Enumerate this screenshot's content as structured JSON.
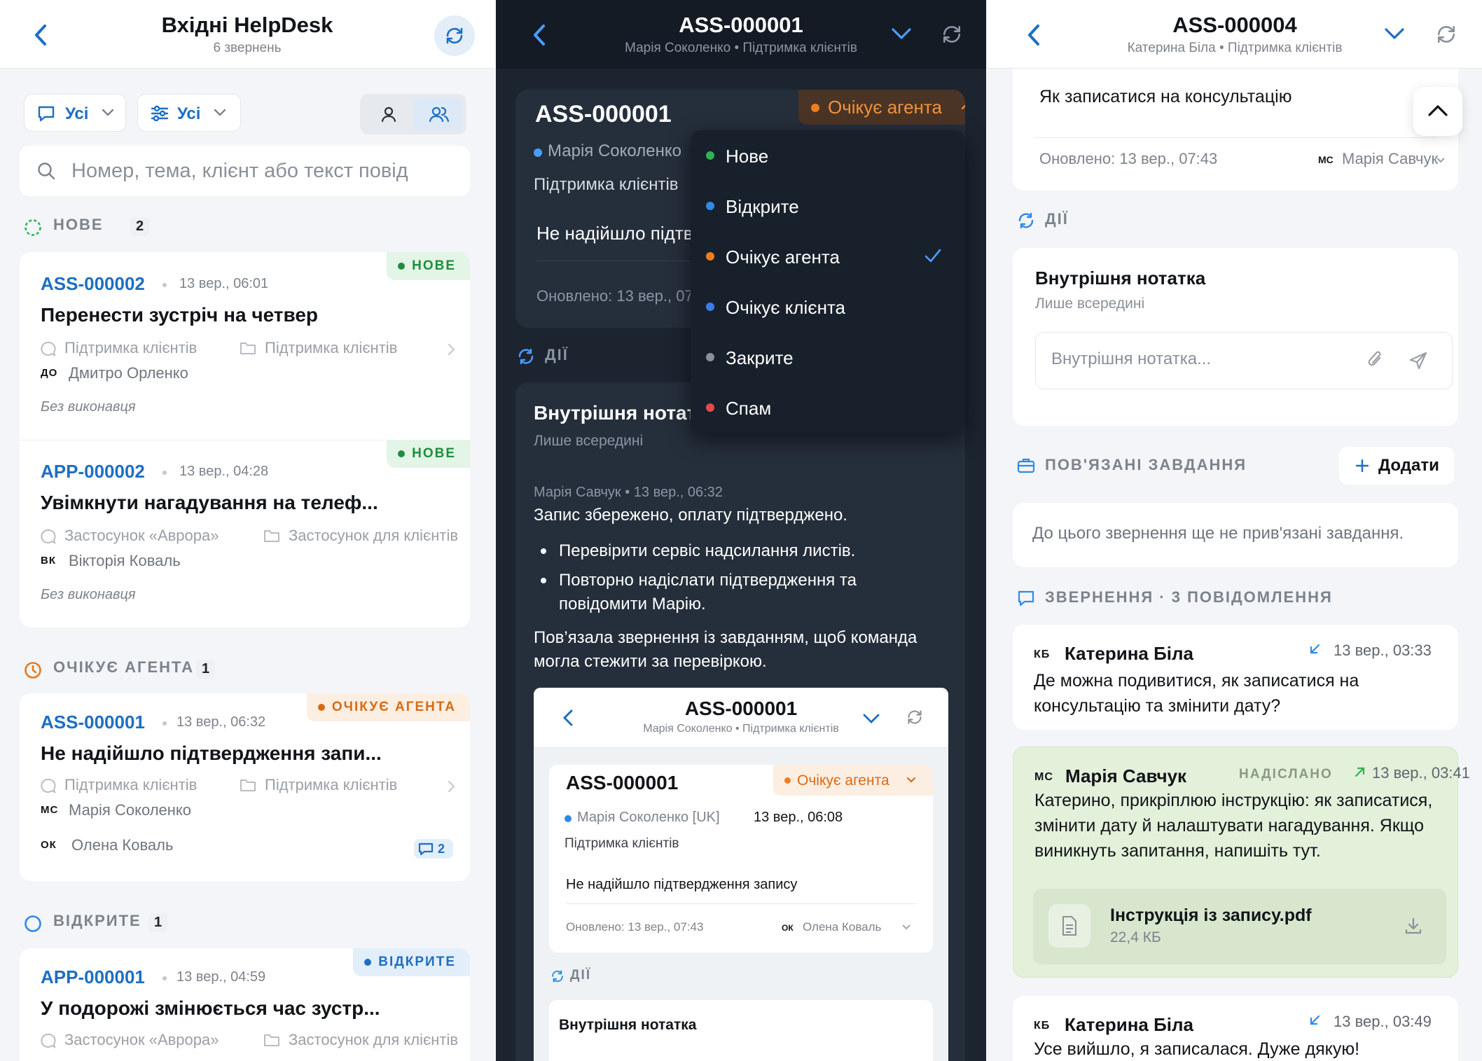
{
  "left": {
    "title": "Вхідні HelpDesk",
    "subtitle": "6 звернень",
    "filter1": "Усі",
    "filter2": "Усі",
    "search_placeholder": "Номер, тема, клієнт або текст повід",
    "groups": [
      {
        "label": "НОВЕ",
        "count": "2"
      },
      {
        "label": "ОЧІКУЄ АГЕНТА",
        "count": "1"
      },
      {
        "label": "ВІДКРИТЕ",
        "count": "1"
      }
    ],
    "tickets": [
      {
        "id": "ASS-000002",
        "time": "13 вер., 06:01",
        "badge": "НОВЕ",
        "title": "Перенести зустріч на четвер",
        "channel": "Підтримка клієнтів",
        "folder": "Підтримка клієнтів",
        "client_initials": "ДО",
        "client": "Дмитро Орленко",
        "assignee": "Без виконавця"
      },
      {
        "id": "APP-000002",
        "time": "13 вер., 04:28",
        "badge": "НОВЕ",
        "title": "Увімкнути нагадування на телеф...",
        "channel": "Застосунок «Аврора»",
        "folder": "Застосунок для клієнтів",
        "client_initials": "ВК",
        "client": "Вікторія Коваль",
        "assignee": "Без виконавця"
      },
      {
        "id": "ASS-000001",
        "time": "13 вер., 06:32",
        "badge": "ОЧІКУЄ АГЕНТА",
        "title": "Не надійшло підтвердження запи...",
        "channel": "Підтримка клієнтів",
        "folder": "Підтримка клієнтів",
        "client_initials": "МС",
        "client": "Марія Соколенко",
        "agent_initials": "ОК",
        "agent": "Олена Коваль",
        "messages": "2"
      },
      {
        "id": "APP-000001",
        "time": "13 вер., 04:59",
        "badge": "ВІДКРИТЕ",
        "title": "У подорожі змінюється час зустр...",
        "channel": "Застосунок «Аврора»",
        "folder": "Застосунок для клієнтів"
      }
    ]
  },
  "middle": {
    "title": "ASS-000001",
    "subtitle": "Марія Соколенко • Підтримка клієнтів",
    "card": {
      "id": "ASS-000001",
      "status": "Очікує агента",
      "client": "Марія Соколенко",
      "channel": "Підтримка клієнтів",
      "subject": "Не надійшло підтв",
      "updated": "Оновлено: 13 вер., 07"
    },
    "menu": [
      {
        "label": "Нове",
        "color": "#2fb352"
      },
      {
        "label": "Відкрите",
        "color": "#2e8ae6"
      },
      {
        "label": "Очікує агента",
        "color": "#f07d1e"
      },
      {
        "label": "Очікує клієнта",
        "color": "#3b7bea"
      },
      {
        "label": "Закрите",
        "color": "#8a9099"
      },
      {
        "label": "Спам",
        "color": "#e5484d"
      }
    ],
    "actions_label": "ДІЇ",
    "note": {
      "title": "Внутрішня нотат",
      "sub": "Лише всередині",
      "author_time": "Марія Савчук • 13 вер., 06:32",
      "line1": "Запис збережено, оплату підтверджено.",
      "bullets": [
        "Перевірити сервіс надсилання листів.",
        "Повторно надіслати підтвердження та повідомити Марію."
      ],
      "footer": "Пов’язала звернення із завданням, щоб команда могла стежити за перевіркою."
    },
    "inner": {
      "title": "ASS-000001",
      "subtitle": "Марія Соколенко • Підтримка клієнтів",
      "id": "ASS-000001",
      "status": "Очікує агента",
      "client": "Марія Соколенко [UK]",
      "date": "13 вер., 06:08",
      "channel": "Підтримка клієнтів",
      "subject": "Не надійшло підтвердження запису",
      "updated": "Оновлено: 13 вер., 07:43",
      "agent_initials": "ОК",
      "agent": "Олена Коваль",
      "actions_label": "ДІЇ",
      "note_title": "Внутрішня нотатка"
    }
  },
  "right": {
    "title": "ASS-000004",
    "subtitle": "Катерина Біла • Підтримка клієнтів",
    "subject": "Як записатися на консультацію",
    "updated": "Оновлено: 13 вер., 07:43",
    "agent_initials": "МС",
    "agent": "Марія Савчук",
    "actions_label": "ДІЇ",
    "note_title": "Внутрішня нотатка",
    "note_sub": "Лише всередині",
    "note_placeholder": "Внутрішня нотатка...",
    "tasks_label": "ПОВ'ЯЗАНІ ЗАВДАННЯ",
    "add_label": "Додати",
    "tasks_empty": "До цього звернення ще не прив'язані завдання.",
    "thread_label": "ЗВЕРНЕННЯ · 3 ПОВІДОМЛЕННЯ",
    "messages": [
      {
        "initials": "КБ",
        "name": "Катерина Біла",
        "time": "13 вер., 03:33",
        "text": "Де можна подивитися, як записатися на консультацію та змінити дату?"
      },
      {
        "initials": "МС",
        "name": "Марія Савчук",
        "status": "НАДІСЛАНО",
        "time": "13 вер., 03:41",
        "text": "Катерино, прикріплюю інструкцію: як записатися, змінити дату й налаштувати нагадування. Якщо виникнуть запитання, напишіть тут.",
        "file_name": "Інструкція із запису.pdf",
        "file_size": "22,4 КБ"
      },
      {
        "initials": "КБ",
        "name": "Катерина Біла",
        "time": "13 вер., 03:49",
        "text": "Усе вийшло, я записалася. Дуже дякую!"
      }
    ]
  }
}
